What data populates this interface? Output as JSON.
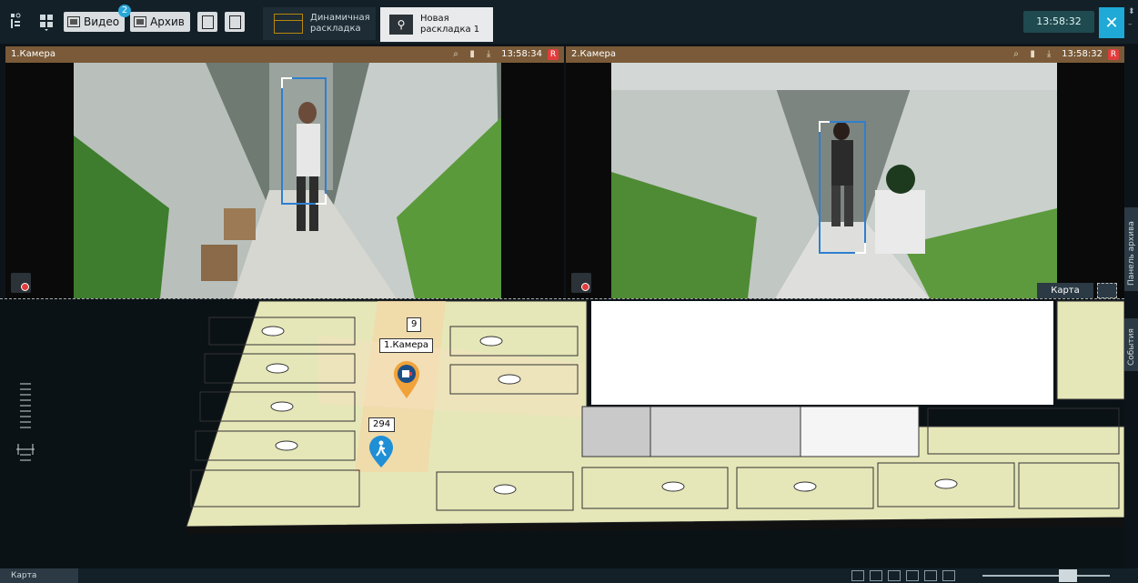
{
  "toolbar": {
    "video_label": "Видео",
    "video_badge": "2",
    "archive_label": "Архив",
    "tabs": [
      {
        "line1": "Динамичная",
        "line2": "раскладка"
      },
      {
        "line1": "Новая",
        "line2": "раскладка 1"
      }
    ],
    "clock": "13:58:32",
    "icons": {
      "layout": "grid-icon",
      "tools": "tools-icon",
      "menu": "menu-icon",
      "search": "search-archive-icon",
      "report": "report-icon"
    }
  },
  "cameras": [
    {
      "title": "1.Камера",
      "time": "13:58:34",
      "rec": "R"
    },
    {
      "title": "2.Камера",
      "time": "13:58:32",
      "rec": "R"
    }
  ],
  "map": {
    "button_label": "Карта",
    "markers": [
      {
        "label": "9"
      },
      {
        "label": "1.Камера"
      },
      {
        "label": "294"
      }
    ]
  },
  "side_tabs": {
    "archive": "Панель архива",
    "events": "События"
  },
  "bottom": {
    "tab_label": "Карта"
  },
  "colors": {
    "accent": "#1ea9d6",
    "camera_header": "#7a5a38",
    "marker": "#f0a23a",
    "bbox": "#2f7fcf"
  }
}
